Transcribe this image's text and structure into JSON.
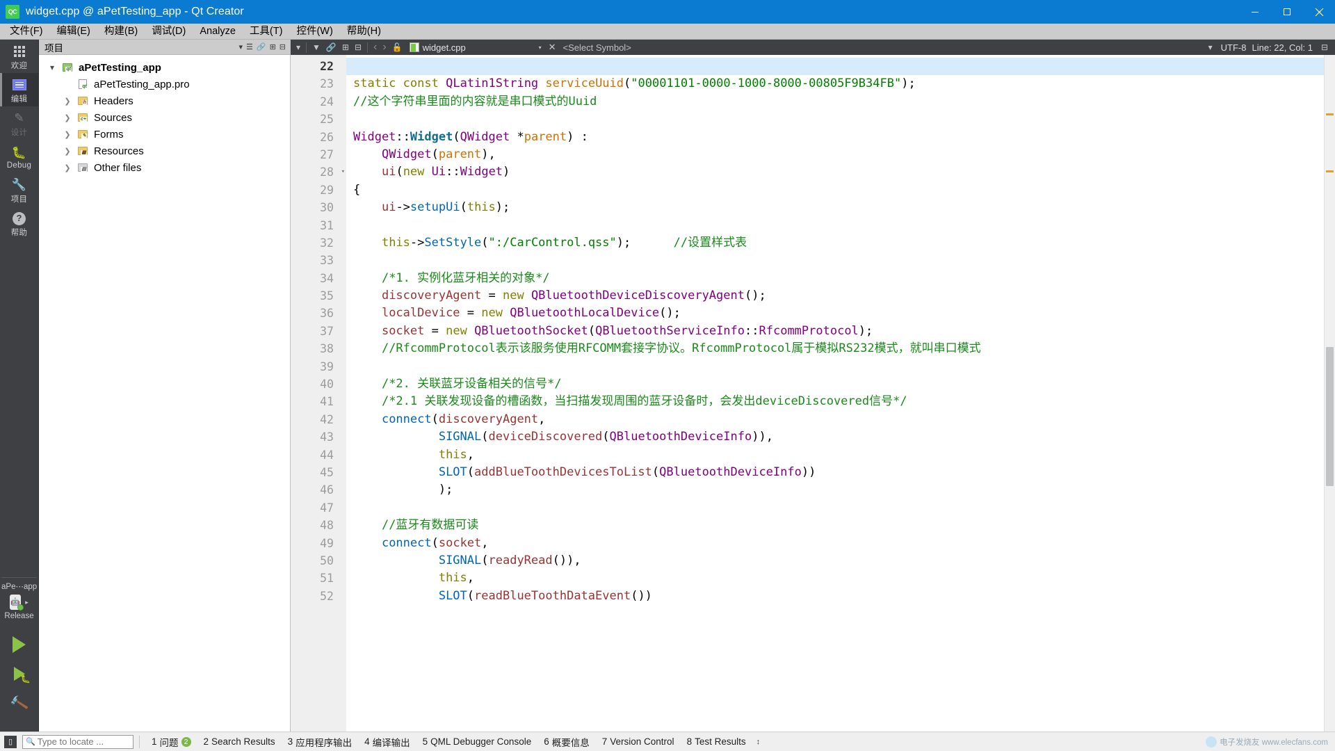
{
  "window": {
    "title": "widget.cpp @ aPetTesting_app - Qt Creator",
    "app_icon": "qt-creator-icon",
    "minimize": "–",
    "maximize": "❐",
    "close": "✕"
  },
  "menubar": {
    "items": [
      {
        "label": "文件(F)"
      },
      {
        "label": "编辑(E)"
      },
      {
        "label": "构建(B)"
      },
      {
        "label": "调试(D)"
      },
      {
        "label": "Analyze"
      },
      {
        "label": "工具(T)"
      },
      {
        "label": "控件(W)"
      },
      {
        "label": "帮助(H)"
      }
    ]
  },
  "modebar": {
    "modes": [
      {
        "label": "欢迎",
        "icon": "grid-icon",
        "state": "normal"
      },
      {
        "label": "编辑",
        "icon": "document-edit-icon",
        "state": "selected"
      },
      {
        "label": "设计",
        "icon": "pencil-icon",
        "state": "disabled"
      },
      {
        "label": "Debug",
        "icon": "bug-icon",
        "state": "normal"
      },
      {
        "label": "项目",
        "icon": "wrench-icon",
        "state": "normal"
      },
      {
        "label": "帮助",
        "icon": "question-mark-icon",
        "state": "normal"
      }
    ],
    "kit": {
      "project": "aPe⋯app",
      "device_icon": "android-device-icon",
      "build_config": "Release",
      "expand_arrow": "▸"
    },
    "actions": [
      {
        "name": "run",
        "icon": "run-triangle-icon"
      },
      {
        "name": "debug",
        "icon": "debug-run-icon"
      },
      {
        "name": "build",
        "icon": "hammer-icon"
      }
    ]
  },
  "project_pane": {
    "header": {
      "title": "项目",
      "icons": [
        "filter-dropdown-icon",
        "filter-icon",
        "link-icon",
        "split-icon",
        "close-icon"
      ]
    },
    "tree": [
      {
        "label": "aPetTesting_app",
        "indent": 0,
        "twisty": "open",
        "icon": "project-folder-icon",
        "bold": true
      },
      {
        "label": "aPetTesting_app.pro",
        "indent": 1,
        "twisty": "none",
        "icon": "pro-file-icon",
        "bold": false
      },
      {
        "label": "Headers",
        "indent": 1,
        "twisty": "closed",
        "icon": "headers-folder-icon",
        "bold": false
      },
      {
        "label": "Sources",
        "indent": 1,
        "twisty": "closed",
        "icon": "sources-folder-icon",
        "bold": false
      },
      {
        "label": "Forms",
        "indent": 1,
        "twisty": "closed",
        "icon": "forms-folder-icon",
        "bold": false
      },
      {
        "label": "Resources",
        "indent": 1,
        "twisty": "closed",
        "icon": "resources-folder-icon",
        "bold": false
      },
      {
        "label": "Other files",
        "indent": 1,
        "twisty": "closed",
        "icon": "other-files-folder-icon",
        "bold": false
      }
    ]
  },
  "editor_toolbar": {
    "left_icons": [
      "filter-dropdown-icon",
      "filter-icon",
      "link-icon",
      "split-icon",
      "close-split-icon"
    ],
    "nav_back": "‹",
    "nav_forward": "›",
    "lock_icon": "unlocked-icon",
    "file_icon": "cpp-file-icon",
    "filename": "widget.cpp",
    "file_dropdown": "▾",
    "close_file": "✕",
    "symbol_selector": "<Select Symbol>",
    "symbol_dropdown": "▾",
    "encoding": "UTF-8",
    "cursor_position": "Line: 22, Col: 1",
    "right_icons": [
      "split-horizontal-icon"
    ]
  },
  "editor": {
    "first_line": 22,
    "current_line": 22,
    "fold_lines": [
      28
    ],
    "lines": [
      {
        "n": 22,
        "tokens": [],
        "current": true
      },
      {
        "n": 23,
        "tokens": [
          {
            "t": "static",
            "c": "k"
          },
          {
            "t": " ",
            "c": "pn"
          },
          {
            "t": "const",
            "c": "k"
          },
          {
            "t": " ",
            "c": "pn"
          },
          {
            "t": "QLatin1String",
            "c": "ty"
          },
          {
            "t": " ",
            "c": "pn"
          },
          {
            "t": "serviceUuid",
            "c": "id"
          },
          {
            "t": "(",
            "c": "pn"
          },
          {
            "t": "\"00001101-0000-1000-8000-00805F9B34FB\"",
            "c": "st"
          },
          {
            "t": ");",
            "c": "pn"
          }
        ]
      },
      {
        "n": 24,
        "tokens": [
          {
            "t": "//这个字符串里面的内容就是串口模式的Uuid",
            "c": "cm"
          }
        ]
      },
      {
        "n": 25,
        "tokens": []
      },
      {
        "n": 26,
        "tokens": [
          {
            "t": "Widget",
            "c": "ty"
          },
          {
            "t": "::",
            "c": "pn"
          },
          {
            "t": "Widget",
            "c": "fnb"
          },
          {
            "t": "(",
            "c": "pn"
          },
          {
            "t": "QWidget",
            "c": "ty"
          },
          {
            "t": " *",
            "c": "pn"
          },
          {
            "t": "parent",
            "c": "id"
          },
          {
            "t": ") :",
            "c": "pn"
          }
        ]
      },
      {
        "n": 27,
        "tokens": [
          {
            "t": "    ",
            "c": "pn"
          },
          {
            "t": "QWidget",
            "c": "ty"
          },
          {
            "t": "(",
            "c": "pn"
          },
          {
            "t": "parent",
            "c": "id"
          },
          {
            "t": "),",
            "c": "pn"
          }
        ]
      },
      {
        "n": 28,
        "tokens": [
          {
            "t": "    ",
            "c": "pn"
          },
          {
            "t": "ui",
            "c": "mem"
          },
          {
            "t": "(",
            "c": "pn"
          },
          {
            "t": "new",
            "c": "k"
          },
          {
            "t": " ",
            "c": "pn"
          },
          {
            "t": "Ui",
            "c": "ty"
          },
          {
            "t": "::",
            "c": "pn"
          },
          {
            "t": "Widget",
            "c": "ty"
          },
          {
            "t": ")",
            "c": "pn"
          }
        ]
      },
      {
        "n": 29,
        "tokens": [
          {
            "t": "{",
            "c": "pn"
          }
        ]
      },
      {
        "n": 30,
        "tokens": [
          {
            "t": "    ",
            "c": "pn"
          },
          {
            "t": "ui",
            "c": "mem"
          },
          {
            "t": "->",
            "c": "pn"
          },
          {
            "t": "setupUi",
            "c": "fn"
          },
          {
            "t": "(",
            "c": "pn"
          },
          {
            "t": "this",
            "c": "k"
          },
          {
            "t": ");",
            "c": "pn"
          }
        ]
      },
      {
        "n": 31,
        "tokens": []
      },
      {
        "n": 32,
        "tokens": [
          {
            "t": "    ",
            "c": "pn"
          },
          {
            "t": "this",
            "c": "k"
          },
          {
            "t": "->",
            "c": "pn"
          },
          {
            "t": "SetStyle",
            "c": "fn"
          },
          {
            "t": "(",
            "c": "pn"
          },
          {
            "t": "\":/CarControl.qss\"",
            "c": "st"
          },
          {
            "t": ");",
            "c": "pn"
          },
          {
            "t": "      ",
            "c": "pn"
          },
          {
            "t": "//设置样式表",
            "c": "cm"
          }
        ]
      },
      {
        "n": 33,
        "tokens": []
      },
      {
        "n": 34,
        "tokens": [
          {
            "t": "    ",
            "c": "pn"
          },
          {
            "t": "/*1. 实例化蓝牙相关的对象*/",
            "c": "cm"
          }
        ]
      },
      {
        "n": 35,
        "tokens": [
          {
            "t": "    ",
            "c": "pn"
          },
          {
            "t": "discoveryAgent",
            "c": "mem"
          },
          {
            "t": " = ",
            "c": "pn"
          },
          {
            "t": "new",
            "c": "k"
          },
          {
            "t": " ",
            "c": "pn"
          },
          {
            "t": "QBluetoothDeviceDiscoveryAgent",
            "c": "ty"
          },
          {
            "t": "();",
            "c": "pn"
          }
        ]
      },
      {
        "n": 36,
        "tokens": [
          {
            "t": "    ",
            "c": "pn"
          },
          {
            "t": "localDevice",
            "c": "mem"
          },
          {
            "t": " = ",
            "c": "pn"
          },
          {
            "t": "new",
            "c": "k"
          },
          {
            "t": " ",
            "c": "pn"
          },
          {
            "t": "QBluetoothLocalDevice",
            "c": "ty"
          },
          {
            "t": "();",
            "c": "pn"
          }
        ]
      },
      {
        "n": 37,
        "tokens": [
          {
            "t": "    ",
            "c": "pn"
          },
          {
            "t": "socket",
            "c": "mem"
          },
          {
            "t": " = ",
            "c": "pn"
          },
          {
            "t": "new",
            "c": "k"
          },
          {
            "t": " ",
            "c": "pn"
          },
          {
            "t": "QBluetoothSocket",
            "c": "ty"
          },
          {
            "t": "(",
            "c": "pn"
          },
          {
            "t": "QBluetoothServiceInfo",
            "c": "ty"
          },
          {
            "t": "::",
            "c": "pn"
          },
          {
            "t": "RfcommProtocol",
            "c": "ty"
          },
          {
            "t": ");",
            "c": "pn"
          }
        ]
      },
      {
        "n": 38,
        "tokens": [
          {
            "t": "    ",
            "c": "pn"
          },
          {
            "t": "//RfcommProtocol表示该服务使用RFCOMM套接字协议。RfcommProtocol属于模拟RS232模式，就叫串口模式",
            "c": "cm"
          }
        ]
      },
      {
        "n": 39,
        "tokens": []
      },
      {
        "n": 40,
        "tokens": [
          {
            "t": "    ",
            "c": "pn"
          },
          {
            "t": "/*2. 关联蓝牙设备相关的信号*/",
            "c": "cm"
          }
        ]
      },
      {
        "n": 41,
        "tokens": [
          {
            "t": "    ",
            "c": "pn"
          },
          {
            "t": "/*2.1 关联发现设备的槽函数，当扫描发现周围的蓝牙设备时，会发出deviceDiscovered信号*/",
            "c": "cm"
          }
        ]
      },
      {
        "n": 42,
        "tokens": [
          {
            "t": "    ",
            "c": "pn"
          },
          {
            "t": "connect",
            "c": "fn"
          },
          {
            "t": "(",
            "c": "pn"
          },
          {
            "t": "discoveryAgent",
            "c": "mem"
          },
          {
            "t": ",",
            "c": "pn"
          }
        ]
      },
      {
        "n": 43,
        "tokens": [
          {
            "t": "            ",
            "c": "pn"
          },
          {
            "t": "SIGNAL",
            "c": "fn"
          },
          {
            "t": "(",
            "c": "pn"
          },
          {
            "t": "deviceDiscovered",
            "c": "mem"
          },
          {
            "t": "(",
            "c": "pn"
          },
          {
            "t": "QBluetoothDeviceInfo",
            "c": "ty"
          },
          {
            "t": ")),",
            "c": "pn"
          }
        ]
      },
      {
        "n": 44,
        "tokens": [
          {
            "t": "            ",
            "c": "pn"
          },
          {
            "t": "this",
            "c": "k"
          },
          {
            "t": ",",
            "c": "pn"
          }
        ]
      },
      {
        "n": 45,
        "tokens": [
          {
            "t": "            ",
            "c": "pn"
          },
          {
            "t": "SLOT",
            "c": "fn"
          },
          {
            "t": "(",
            "c": "pn"
          },
          {
            "t": "addBlueToothDevicesToList",
            "c": "mem"
          },
          {
            "t": "(",
            "c": "pn"
          },
          {
            "t": "QBluetoothDeviceInfo",
            "c": "ty"
          },
          {
            "t": "))",
            "c": "pn"
          }
        ]
      },
      {
        "n": 46,
        "tokens": [
          {
            "t": "            ",
            "c": "pn"
          },
          {
            "t": ");",
            "c": "pn"
          }
        ]
      },
      {
        "n": 47,
        "tokens": []
      },
      {
        "n": 48,
        "tokens": [
          {
            "t": "    ",
            "c": "pn"
          },
          {
            "t": "//蓝牙有数据可读",
            "c": "cm"
          }
        ]
      },
      {
        "n": 49,
        "tokens": [
          {
            "t": "    ",
            "c": "pn"
          },
          {
            "t": "connect",
            "c": "fn"
          },
          {
            "t": "(",
            "c": "pn"
          },
          {
            "t": "socket",
            "c": "mem"
          },
          {
            "t": ",",
            "c": "pn"
          }
        ]
      },
      {
        "n": 50,
        "tokens": [
          {
            "t": "            ",
            "c": "pn"
          },
          {
            "t": "SIGNAL",
            "c": "fn"
          },
          {
            "t": "(",
            "c": "pn"
          },
          {
            "t": "readyRead",
            "c": "mem"
          },
          {
            "t": "()),",
            "c": "pn"
          }
        ]
      },
      {
        "n": 51,
        "tokens": [
          {
            "t": "            ",
            "c": "pn"
          },
          {
            "t": "this",
            "c": "k"
          },
          {
            "t": ",",
            "c": "pn"
          }
        ]
      },
      {
        "n": 52,
        "tokens": [
          {
            "t": "            ",
            "c": "pn"
          },
          {
            "t": "SLOT",
            "c": "fn"
          },
          {
            "t": "(",
            "c": "pn"
          },
          {
            "t": "readBlueToothDataEvent",
            "c": "mem"
          },
          {
            "t": "())",
            "c": "pn"
          }
        ]
      }
    ]
  },
  "statusbar": {
    "toggle_icon": "output-pane-toggle-icon",
    "locator_placeholder": "Type to locate ...",
    "locator_icon": "search-icon",
    "panes": [
      {
        "num": "1",
        "label": "问题",
        "badge": "2"
      },
      {
        "num": "2",
        "label": "Search Results",
        "badge": ""
      },
      {
        "num": "3",
        "label": "应用程序输出",
        "badge": ""
      },
      {
        "num": "4",
        "label": "编译输出",
        "badge": ""
      },
      {
        "num": "5",
        "label": "QML Debugger Console",
        "badge": ""
      },
      {
        "num": "6",
        "label": "概要信息",
        "badge": ""
      },
      {
        "num": "7",
        "label": "Version Control",
        "badge": ""
      },
      {
        "num": "8",
        "label": "Test Results",
        "badge": ""
      }
    ],
    "updown": "↕",
    "watermark": "电子发烧友 www.elecfans.com"
  }
}
